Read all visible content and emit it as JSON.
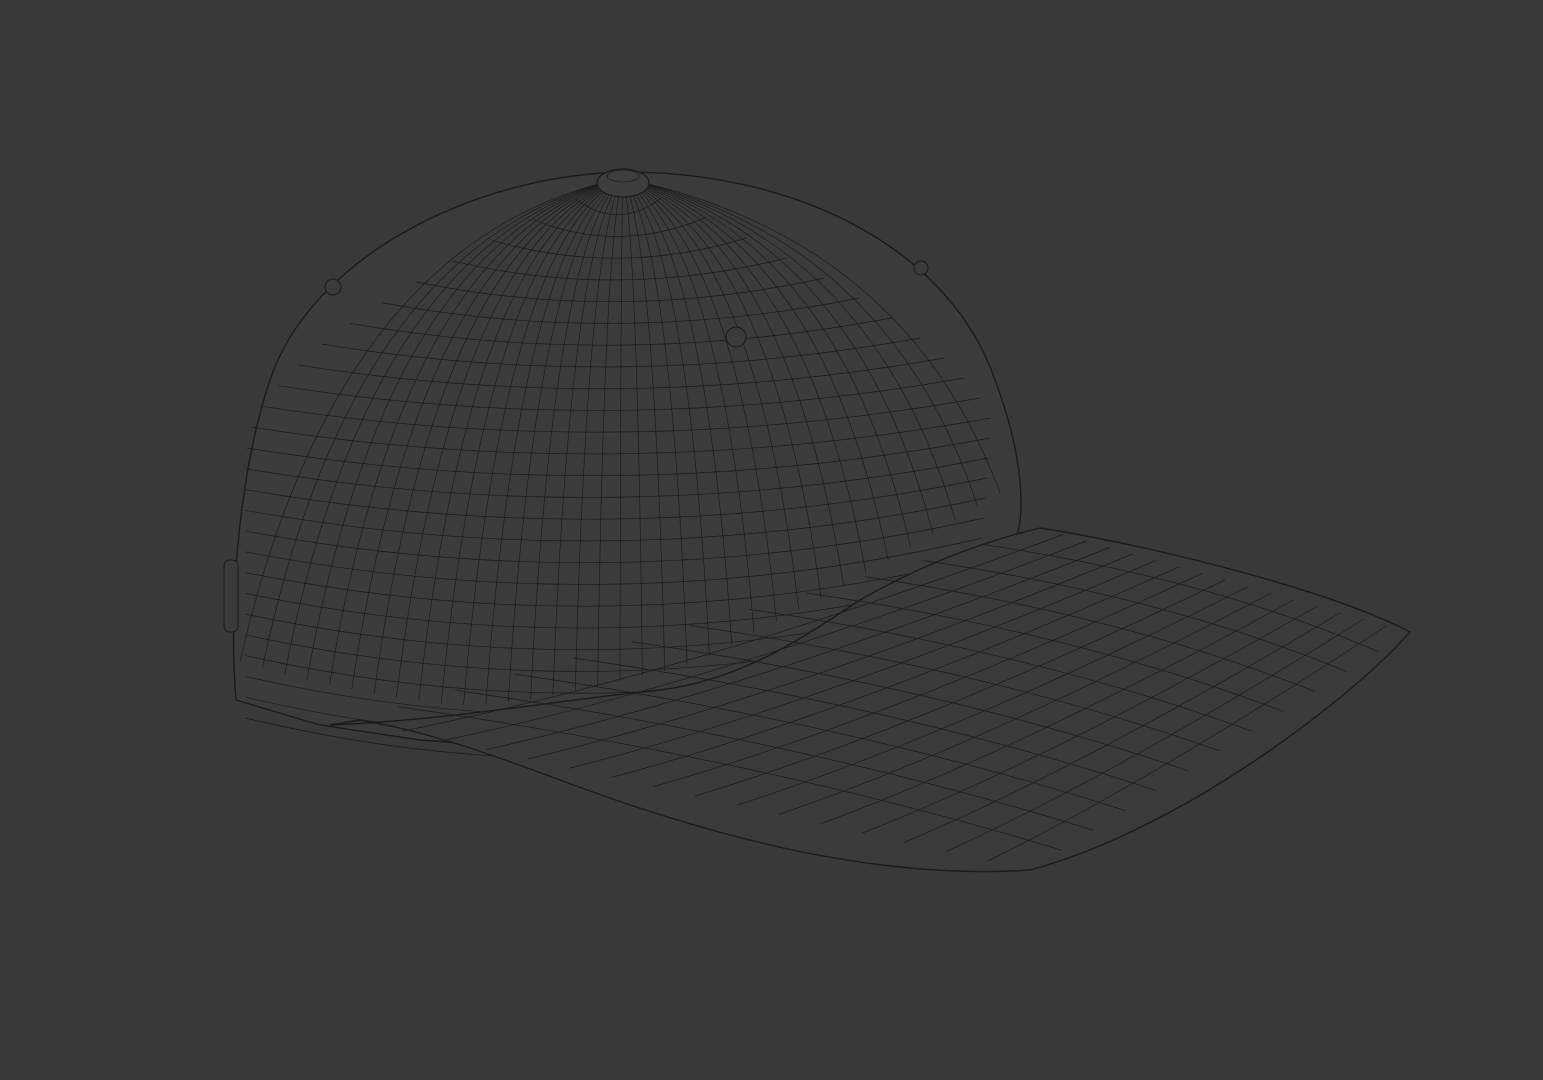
{
  "scene": {
    "background_color": "#393939",
    "object": "baseball-cap",
    "render_style": "wireframe",
    "wire_color": "#1b1b1b",
    "surface_color": "#3b3b3b"
  }
}
